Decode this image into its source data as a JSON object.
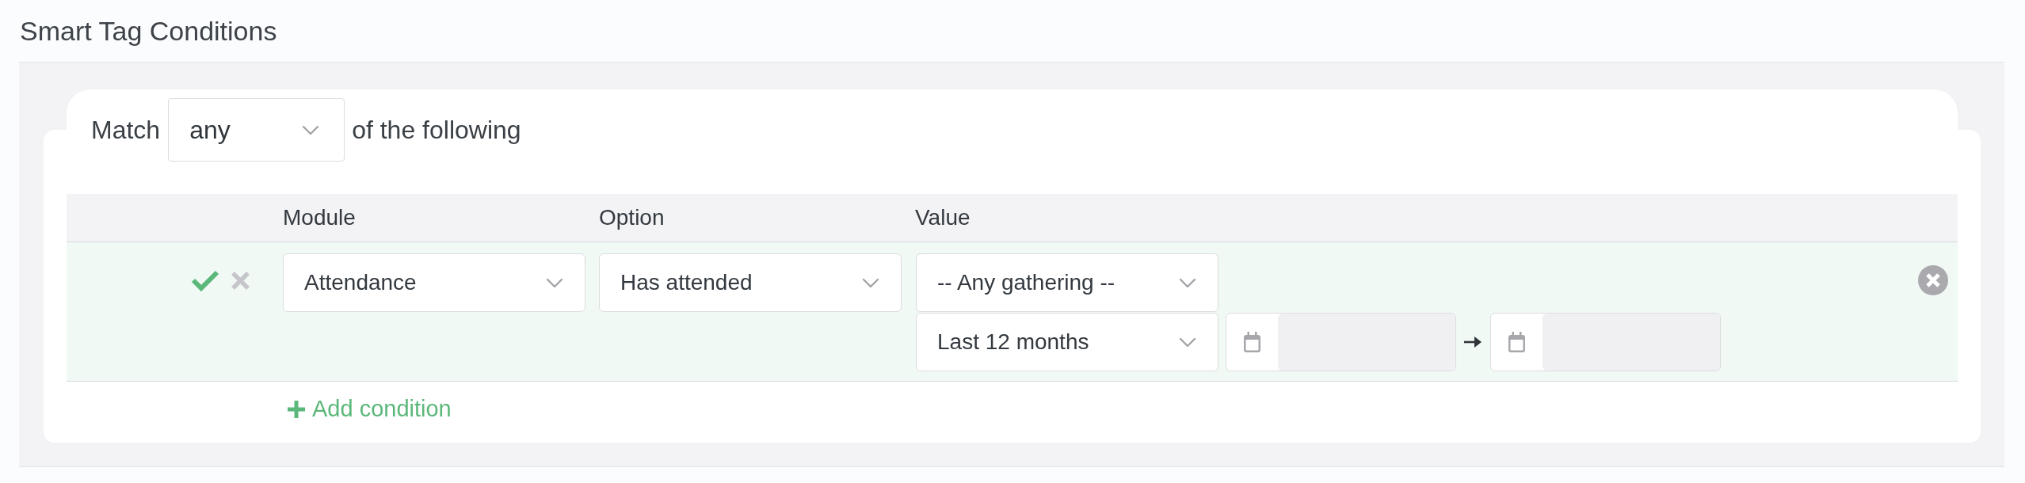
{
  "section_title": "Smart Tag Conditions",
  "match": {
    "label": "Match",
    "value": "any",
    "suffix": "of the following"
  },
  "table": {
    "columns": [
      "Module",
      "Option",
      "Value"
    ],
    "rows": [
      {
        "editing": true,
        "module": "Attendance",
        "option": "Has attended",
        "gathering": "-- Any gathering --",
        "period": "Last 12 months"
      }
    ]
  },
  "add_button": {
    "label": "Add condition"
  }
}
